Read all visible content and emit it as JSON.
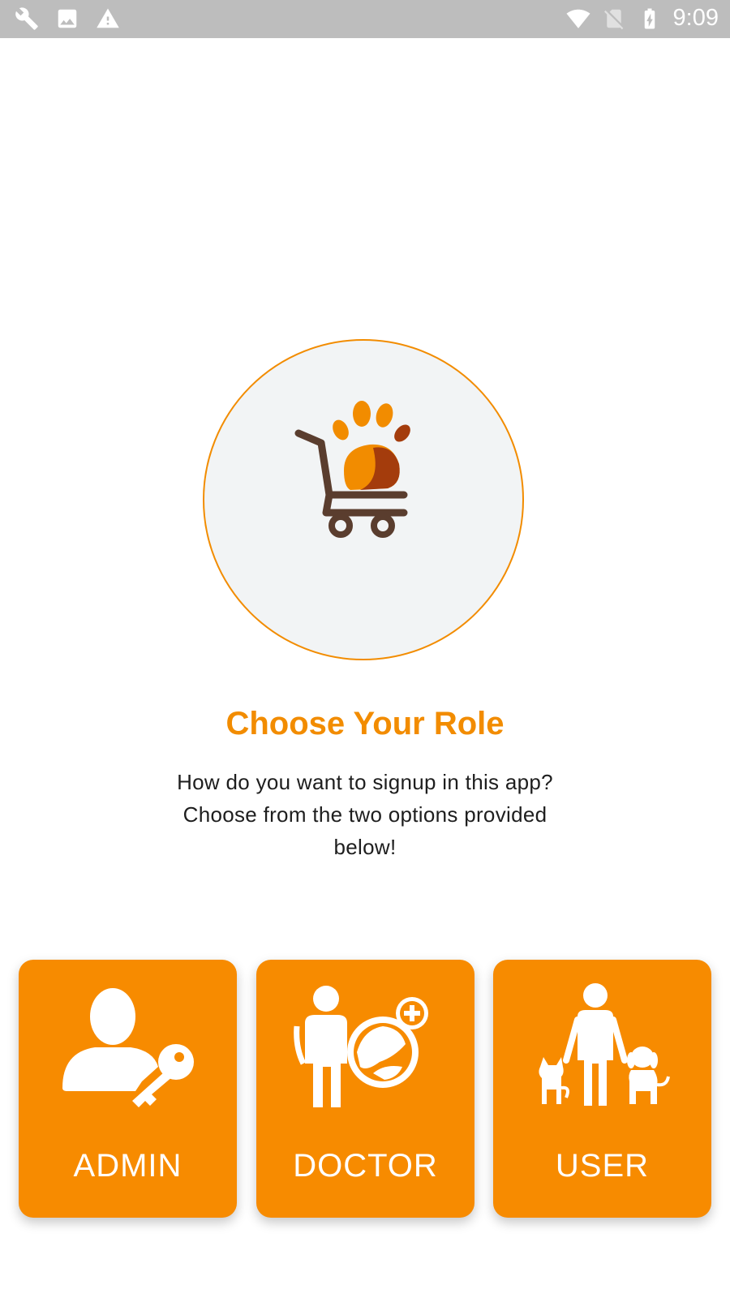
{
  "status_bar": {
    "time": "9:09",
    "left_icons": [
      "wrench-icon",
      "image-icon",
      "warning-icon"
    ],
    "right_icons": [
      "wifi-icon",
      "no-sim-icon",
      "battery-charging-icon"
    ]
  },
  "logo": {
    "icon": "paw-shopping-cart-icon"
  },
  "title": "Choose Your Role",
  "subtitle_lines": [
    "How do you want to signup in this app?",
    "Choose from the two options provided",
    "below!"
  ],
  "roles": [
    {
      "label": "ADMIN",
      "icon": "admin-key-icon"
    },
    {
      "label": "DOCTOR",
      "icon": "vet-doctor-icon"
    },
    {
      "label": "USER",
      "icon": "pet-owner-icon"
    }
  ],
  "colors": {
    "accent": "#f78b00",
    "title": "#f28c00",
    "status_bar": "#bdbdbd",
    "circle_bg": "#f2f4f5"
  }
}
